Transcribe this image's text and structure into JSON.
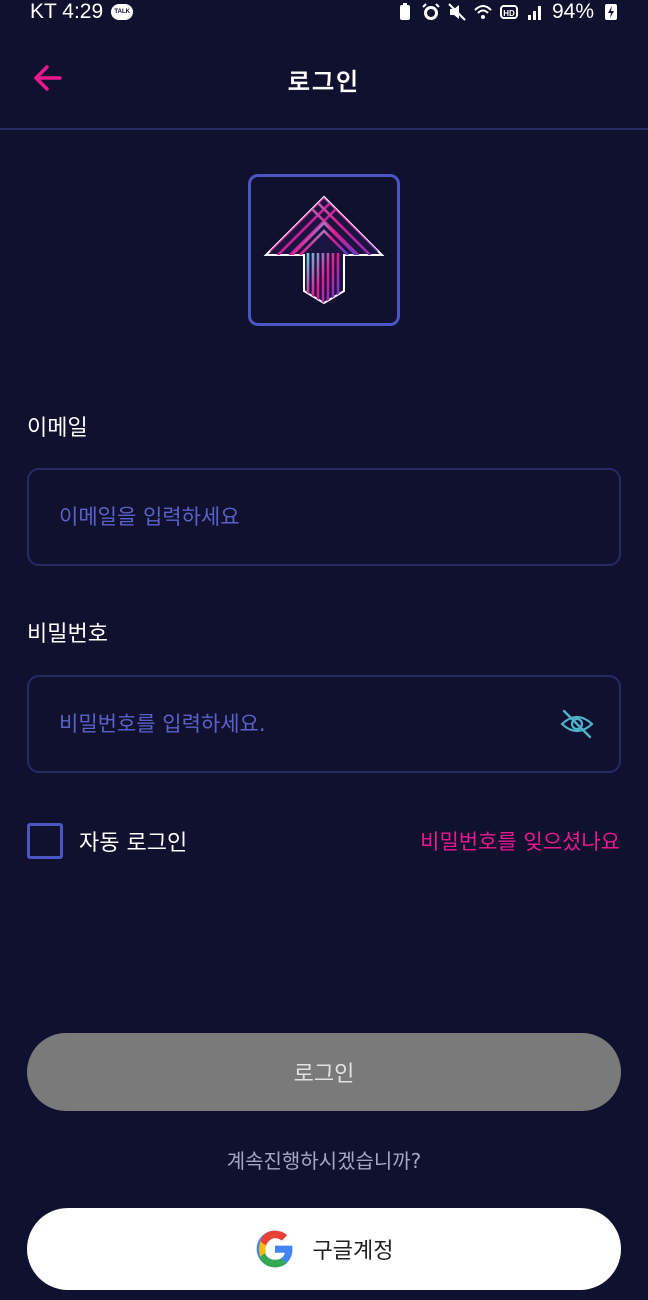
{
  "status_bar": {
    "carrier_time": "KT 4:29",
    "talk_badge": "TALK",
    "battery": "94%",
    "icons": [
      "battery-saver-icon",
      "alarm-icon",
      "mute-icon",
      "wifi-icon",
      "hd-icon",
      "signal-icon",
      "charging-icon"
    ]
  },
  "header": {
    "title": "로그인",
    "back_icon": "arrow-left-icon"
  },
  "logo": {
    "icon": "up-arrow-logo-icon"
  },
  "form": {
    "email_label": "이메일",
    "email_placeholder": "이메일을 입력하세요",
    "email_value": "",
    "password_label": "비밀번호",
    "password_placeholder": "비밀번호를 입력하세요.",
    "password_value": "",
    "visibility_icon": "eye-off-icon",
    "auto_login_label": "자동 로그인",
    "auto_login_checked": false,
    "forgot_password": "비밀번호를 잊으셨나요"
  },
  "actions": {
    "login_button": "로그인",
    "continue_prompt": "계속진행하시겠습니까?",
    "google_button": "구글계정",
    "google_icon": "google-g-icon"
  },
  "colors": {
    "background": "#10112f",
    "accent": "#e8198f",
    "border": "#262b66",
    "placeholder": "#5a61c9",
    "disabled_button": "#7a7a7a"
  }
}
